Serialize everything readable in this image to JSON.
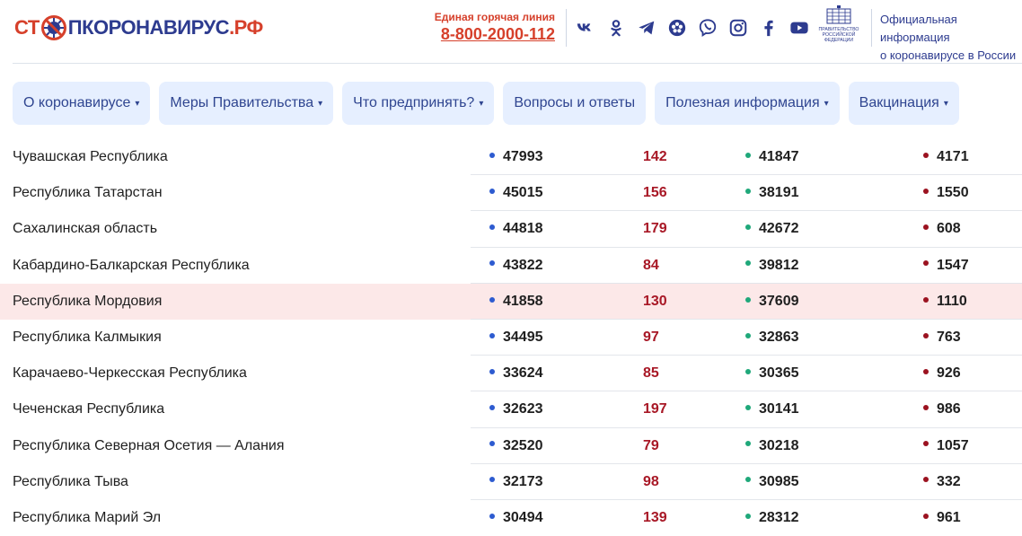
{
  "header": {
    "logo_part1": "СТ",
    "logo_part2": "ПКОРОНАВИРУС",
    "logo_part3": ".РФ",
    "hotline_label": "Единая горячая линия",
    "hotline_number": "8-800-2000-112",
    "socials": [
      "vk-icon",
      "odnoklassniki-icon",
      "telegram-icon",
      "flower-app-icon",
      "viber-icon",
      "instagram-icon",
      "facebook-icon",
      "youtube-icon"
    ],
    "gov_emblem_text": [
      "ПРАВИТЕЛЬСТВО",
      "РОССИЙСКОЙ",
      "ФЕДЕРАЦИИ"
    ],
    "official_info_line1": "Официальная информация",
    "official_info_line2": "о коронавирусе в России"
  },
  "nav": [
    {
      "label": "О коронавирусе",
      "dropdown": true
    },
    {
      "label": "Меры Правительства",
      "dropdown": true
    },
    {
      "label": "Что предпринять?",
      "dropdown": true
    },
    {
      "label": "Вопросы и ответы",
      "dropdown": false
    },
    {
      "label": "Полезная информация",
      "dropdown": true
    },
    {
      "label": "Вакцинация",
      "dropdown": true
    }
  ],
  "dropdown_arrow": "▾",
  "rows": [
    {
      "region": "Чувашская Республика",
      "sick": "47993",
      "new": "142",
      "healed": "41847",
      "died": "4171"
    },
    {
      "region": "Республика Татарстан",
      "sick": "45015",
      "new": "156",
      "healed": "38191",
      "died": "1550"
    },
    {
      "region": "Сахалинская область",
      "sick": "44818",
      "new": "179",
      "healed": "42672",
      "died": "608"
    },
    {
      "region": "Кабардино-Балкарская Республика",
      "sick": "43822",
      "new": "84",
      "healed": "39812",
      "died": "1547"
    },
    {
      "region": "Республика Мордовия",
      "sick": "41858",
      "new": "130",
      "healed": "37609",
      "died": "1110",
      "highlighted": true
    },
    {
      "region": "Республика Калмыкия",
      "sick": "34495",
      "new": "97",
      "healed": "32863",
      "died": "763"
    },
    {
      "region": "Карачаево-Черкесская Республика",
      "sick": "33624",
      "new": "85",
      "healed": "30365",
      "died": "926"
    },
    {
      "region": "Чеченская Республика",
      "sick": "32623",
      "new": "197",
      "healed": "30141",
      "died": "986"
    },
    {
      "region": "Республика Северная Осетия — Алания",
      "sick": "32520",
      "new": "79",
      "healed": "30218",
      "died": "1057"
    },
    {
      "region": "Республика Тыва",
      "sick": "32173",
      "new": "98",
      "healed": "30985",
      "died": "332"
    },
    {
      "region": "Республика Марий Эл",
      "sick": "30494",
      "new": "139",
      "healed": "28312",
      "died": "961"
    }
  ],
  "colors": {
    "brand_red": "#d6402b",
    "brand_blue": "#2d3b8f",
    "nav_bg": "#e6efff",
    "highlight_row": "#fce8e8",
    "sick_dot": "#2d5bd0",
    "healed_dot": "#1fa87a",
    "died_dot": "#9b1220",
    "new_cases_text": "#a81826"
  }
}
